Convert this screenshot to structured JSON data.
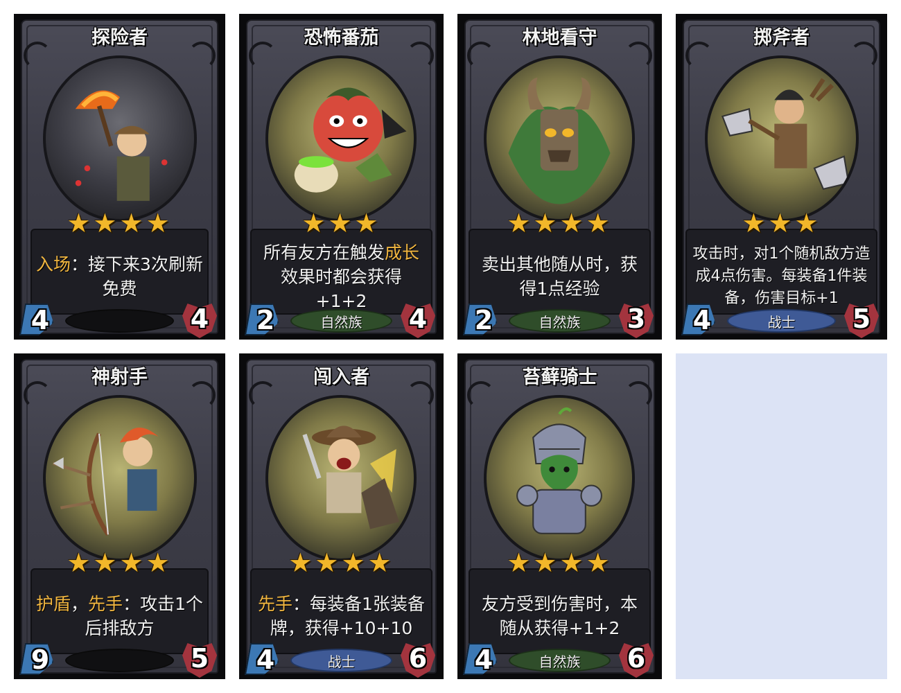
{
  "cards": [
    {
      "name": "探险者",
      "stars": 4,
      "description": [
        {
          "text": "入场",
          "kw": true
        },
        {
          "text": "：接下来3次刷新免费",
          "kw": false
        }
      ],
      "cost": "4",
      "health": "4",
      "tribe": ""
    },
    {
      "name": "恐怖番茄",
      "stars": 3,
      "description": [
        {
          "text": "所有友方在触发",
          "kw": false
        },
        {
          "text": "成长",
          "kw": true
        },
        {
          "text": "效果时都会获得+1+2",
          "kw": false
        }
      ],
      "cost": "2",
      "health": "4",
      "tribe": "自然族"
    },
    {
      "name": "林地看守",
      "stars": 4,
      "description": [
        {
          "text": "卖出其他随从时，获得1点经验",
          "kw": false
        }
      ],
      "cost": "2",
      "health": "3",
      "tribe": "自然族"
    },
    {
      "name": "掷斧者",
      "stars": 3,
      "description": [
        {
          "text": "攻击时，对1个随机敌方造成4点伤害。每装备1件装备，伤害目标+1",
          "kw": false
        }
      ],
      "cost": "4",
      "health": "5",
      "tribe": "战士"
    },
    {
      "name": "神射手",
      "stars": 4,
      "description": [
        {
          "text": "护盾",
          "kw": true
        },
        {
          "text": "，",
          "kw": false
        },
        {
          "text": "先手",
          "kw": true
        },
        {
          "text": "：攻击1个后排敌方",
          "kw": false
        }
      ],
      "cost": "9",
      "health": "5",
      "tribe": ""
    },
    {
      "name": "闯入者",
      "stars": 4,
      "description": [
        {
          "text": "先手",
          "kw": true
        },
        {
          "text": "：每装备1张装备牌，获得+10+10",
          "kw": false
        }
      ],
      "cost": "4",
      "health": "6",
      "tribe": "战士"
    },
    {
      "name": "苔藓骑士",
      "stars": 4,
      "description": [
        {
          "text": "友方受到伤害时，本随从获得+1+2",
          "kw": false
        }
      ],
      "cost": "4",
      "health": "6",
      "tribe": "自然族"
    }
  ],
  "colors": {
    "keyword": "#f1b640",
    "star": "#f2b72a",
    "cost_gem": "#3c78b4",
    "health_shield": "#a3343e",
    "tribe_nature": "#2f4d2a",
    "tribe_warrior": "#3f5a96",
    "empty_slot": "#dce3f5"
  }
}
